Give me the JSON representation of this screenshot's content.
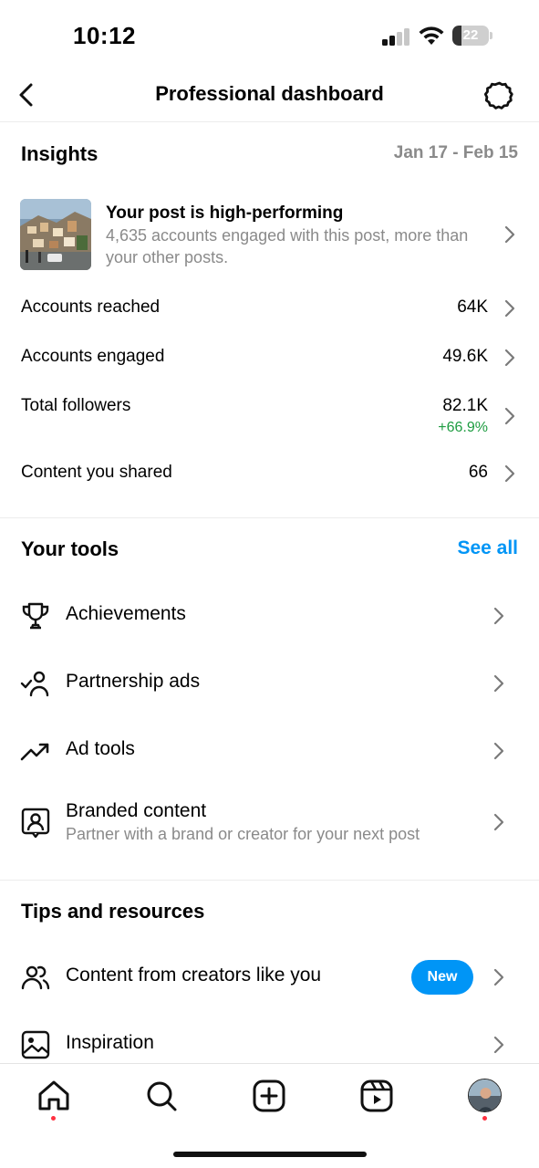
{
  "status_bar": {
    "time": "10:12",
    "battery": "22"
  },
  "header": {
    "title": "Professional dashboard",
    "back_icon": "chevron-left-icon",
    "settings_icon": "gear-icon"
  },
  "insights": {
    "title": "Insights",
    "date_range": "Jan 17 - Feb 15",
    "post": {
      "title": "Your post is high-performing",
      "description": "4,635 accounts engaged with this post, more than your other posts."
    },
    "metrics": [
      {
        "label": "Accounts reached",
        "value": "64K"
      },
      {
        "label": "Accounts engaged",
        "value": "49.6K"
      },
      {
        "label": "Total followers",
        "value": "82.1K",
        "delta": "+66.9%"
      },
      {
        "label": "Content you shared",
        "value": "66"
      }
    ]
  },
  "tools": {
    "title": "Your tools",
    "see_all": "See all",
    "items": [
      {
        "label": "Achievements",
        "icon": "trophy-icon"
      },
      {
        "label": "Partnership ads",
        "icon": "partnership-icon"
      },
      {
        "label": "Ad tools",
        "icon": "trending-up-icon"
      },
      {
        "label": "Branded content",
        "sublabel": "Partner with a brand or creator for your next post",
        "icon": "branded-content-icon"
      }
    ]
  },
  "tips": {
    "title": "Tips and resources",
    "items": [
      {
        "label": "Content from creators like you",
        "badge": "New",
        "icon": "people-icon"
      },
      {
        "label": "Inspiration",
        "icon": "image-icon"
      }
    ]
  },
  "bottom_nav": {
    "items": [
      "home-icon",
      "search-icon",
      "create-icon",
      "reels-icon",
      "profile-avatar"
    ]
  },
  "colors": {
    "accent": "#0095f6",
    "positive": "#1e9c41",
    "secondary_text": "#8a8a8a",
    "notification": "#ff3040"
  }
}
